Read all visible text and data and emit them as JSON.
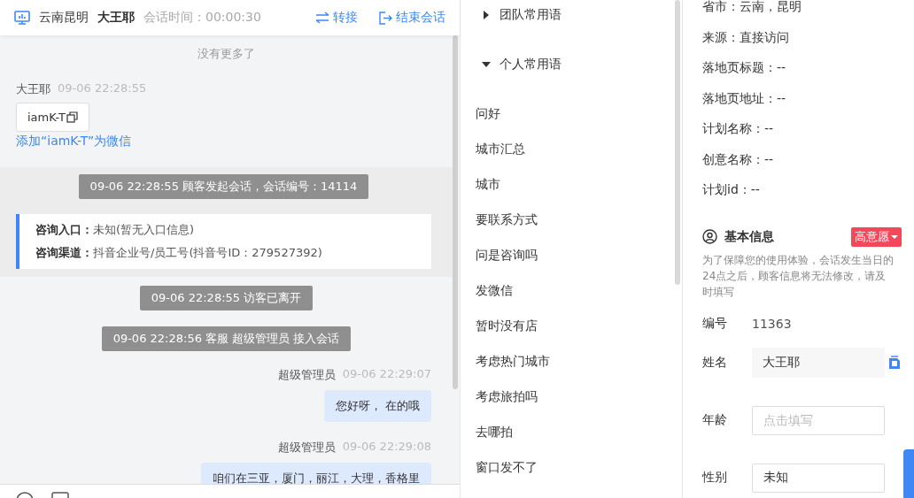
{
  "header": {
    "location": "云南昆明",
    "visitor": "大王耶",
    "session_time": "会话时间：00:00:30",
    "actions": [
      {
        "kind": "transfer",
        "label": "转接"
      },
      {
        "kind": "end",
        "label": "结束会话"
      }
    ]
  },
  "chat": {
    "top_note": "没有更多了",
    "messages": [
      {
        "kind": "customer",
        "sender": "大王耶",
        "time": "09-06 22:28:55",
        "card": "iamK-T",
        "link": "添加“iamK-T”为微信"
      },
      {
        "kind": "session",
        "notice": "09-06 22:28:55 顾客发起会话，会话编号：14114",
        "entries": [
          {
            "label": "咨询入口：",
            "value": "未知(暂无入口信息)"
          },
          {
            "label": "咨询渠道：",
            "value": "抖音企业号/员工号(抖音号ID：279527392)"
          }
        ]
      },
      {
        "kind": "notice",
        "text": "09-06 22:28:55 访客已离开"
      },
      {
        "kind": "notice",
        "text": "09-06 22:28:56 客服 超级管理员 接入会话"
      },
      {
        "kind": "agent",
        "sender": "超级管理员",
        "time": "09-06 22:29:07",
        "text": "您好呀， 在的哦"
      },
      {
        "kind": "agent",
        "sender": "超级管理员",
        "time": "09-06 22:29:08",
        "text": "咱们在三亚，厦门，丽江，大理，香格里"
      }
    ]
  },
  "phrases": [
    {
      "title": "团队常用语",
      "expanded": false
    },
    {
      "title": "个人常用语",
      "expanded": true,
      "items": [
        "问好",
        "城市汇总",
        "城市",
        "要联系方式",
        "问是咨询吗",
        "发微信",
        "暂时没有店",
        "考虑热门城市",
        "考虑旅拍吗",
        "去哪拍",
        "窗口发不了"
      ]
    }
  ],
  "visit_info": [
    "省市：云南，昆明",
    "来源：直接访问",
    "落地页标题：--",
    "落地页地址：--",
    "计划名称：--",
    "创意名称：--",
    "计划id：--"
  ],
  "basic_info": {
    "title": "基本信息",
    "intent": "高意愿",
    "notice": "为了保障您的使用体验，会话发生当日的24点之后，顾客信息将无法修改，请及时填写",
    "fields": [
      {
        "kind": "text",
        "label": "编号",
        "value": "11363"
      },
      {
        "kind": "filled",
        "label": "姓名",
        "value": "大王耶"
      },
      {
        "kind": "input",
        "label": "年龄",
        "placeholder": "点击填写"
      },
      {
        "kind": "input",
        "label": "性别",
        "value": "未知"
      }
    ]
  }
}
